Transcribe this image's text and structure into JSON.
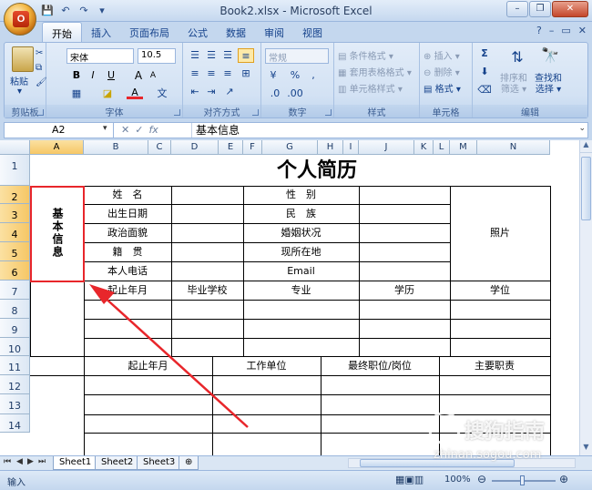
{
  "window": {
    "title": "Book2.xlsx - Microsoft Excel",
    "office_button": "Office",
    "minimize": "–",
    "restore": "❐",
    "close": "✕"
  },
  "qat": [
    "💾",
    "↶",
    "↷",
    "▾"
  ],
  "tabs": [
    {
      "label": "开始",
      "active": true
    },
    {
      "label": "插入"
    },
    {
      "label": "页面布局"
    },
    {
      "label": "公式"
    },
    {
      "label": "数据"
    },
    {
      "label": "审阅"
    },
    {
      "label": "视图"
    }
  ],
  "ribbon_right": [
    "?",
    "–",
    "▭",
    "✕"
  ],
  "ribbon": {
    "clipboard": {
      "label": "剪贴板",
      "paste": "粘贴"
    },
    "font": {
      "label": "字体",
      "name": "宋体",
      "size": "10.5",
      "bold": "B",
      "italic": "I",
      "underline": "U",
      "grow": "A",
      "shrink": "A",
      "color": "A"
    },
    "alignment": {
      "label": "对齐方式"
    },
    "number": {
      "label": "数字",
      "format": "常规",
      "percent": "%",
      "comma": ","
    },
    "styles": {
      "label": "样式",
      "conditional": "条件格式",
      "table": "套用表格格式",
      "cell": "单元格样式"
    },
    "cells": {
      "label": "单元格",
      "insert": "插入",
      "delete": "删除",
      "format": "格式"
    },
    "editing": {
      "label": "编辑",
      "sort": "排序和",
      "filter": "筛选",
      "find": "查找和",
      "select": "选择"
    }
  },
  "formula_bar": {
    "name_box": "A2",
    "fx": "fx",
    "value": "基本信息"
  },
  "columns": [
    "A",
    "B",
    "C",
    "D",
    "E",
    "F",
    "G",
    "H",
    "I",
    "J",
    "K",
    "L",
    "M",
    "N"
  ],
  "rows": [
    "1",
    "2",
    "3",
    "4",
    "5",
    "6",
    "7",
    "8",
    "9",
    "10",
    "11",
    "12",
    "13",
    "14"
  ],
  "sheet": {
    "title": "个人简历",
    "section_label": "基本信息",
    "left_labels": [
      "姓　名",
      "出生日期",
      "政治面貌",
      "籍　贯",
      "本人电话"
    ],
    "right_labels": [
      "性　别",
      "民　族",
      "婚姻状况",
      "现所在地",
      "Email"
    ],
    "photo": "照片",
    "edu_headers": [
      "起止年月",
      "毕业学校",
      "专业",
      "学历",
      "学位"
    ],
    "work_headers": [
      "起止年月",
      "工作单位",
      "最终职位/岗位",
      "主要职责"
    ]
  },
  "sheet_tabs": [
    "Sheet1",
    "Sheet2",
    "Sheet3"
  ],
  "status": {
    "mode": "输入",
    "zoom": "100%"
  },
  "watermark": {
    "brand": "搜狗指南",
    "url": "zhinan.sogou.com"
  },
  "colors": {
    "highlight": "#e8262b",
    "arrow": "#e8262b"
  }
}
